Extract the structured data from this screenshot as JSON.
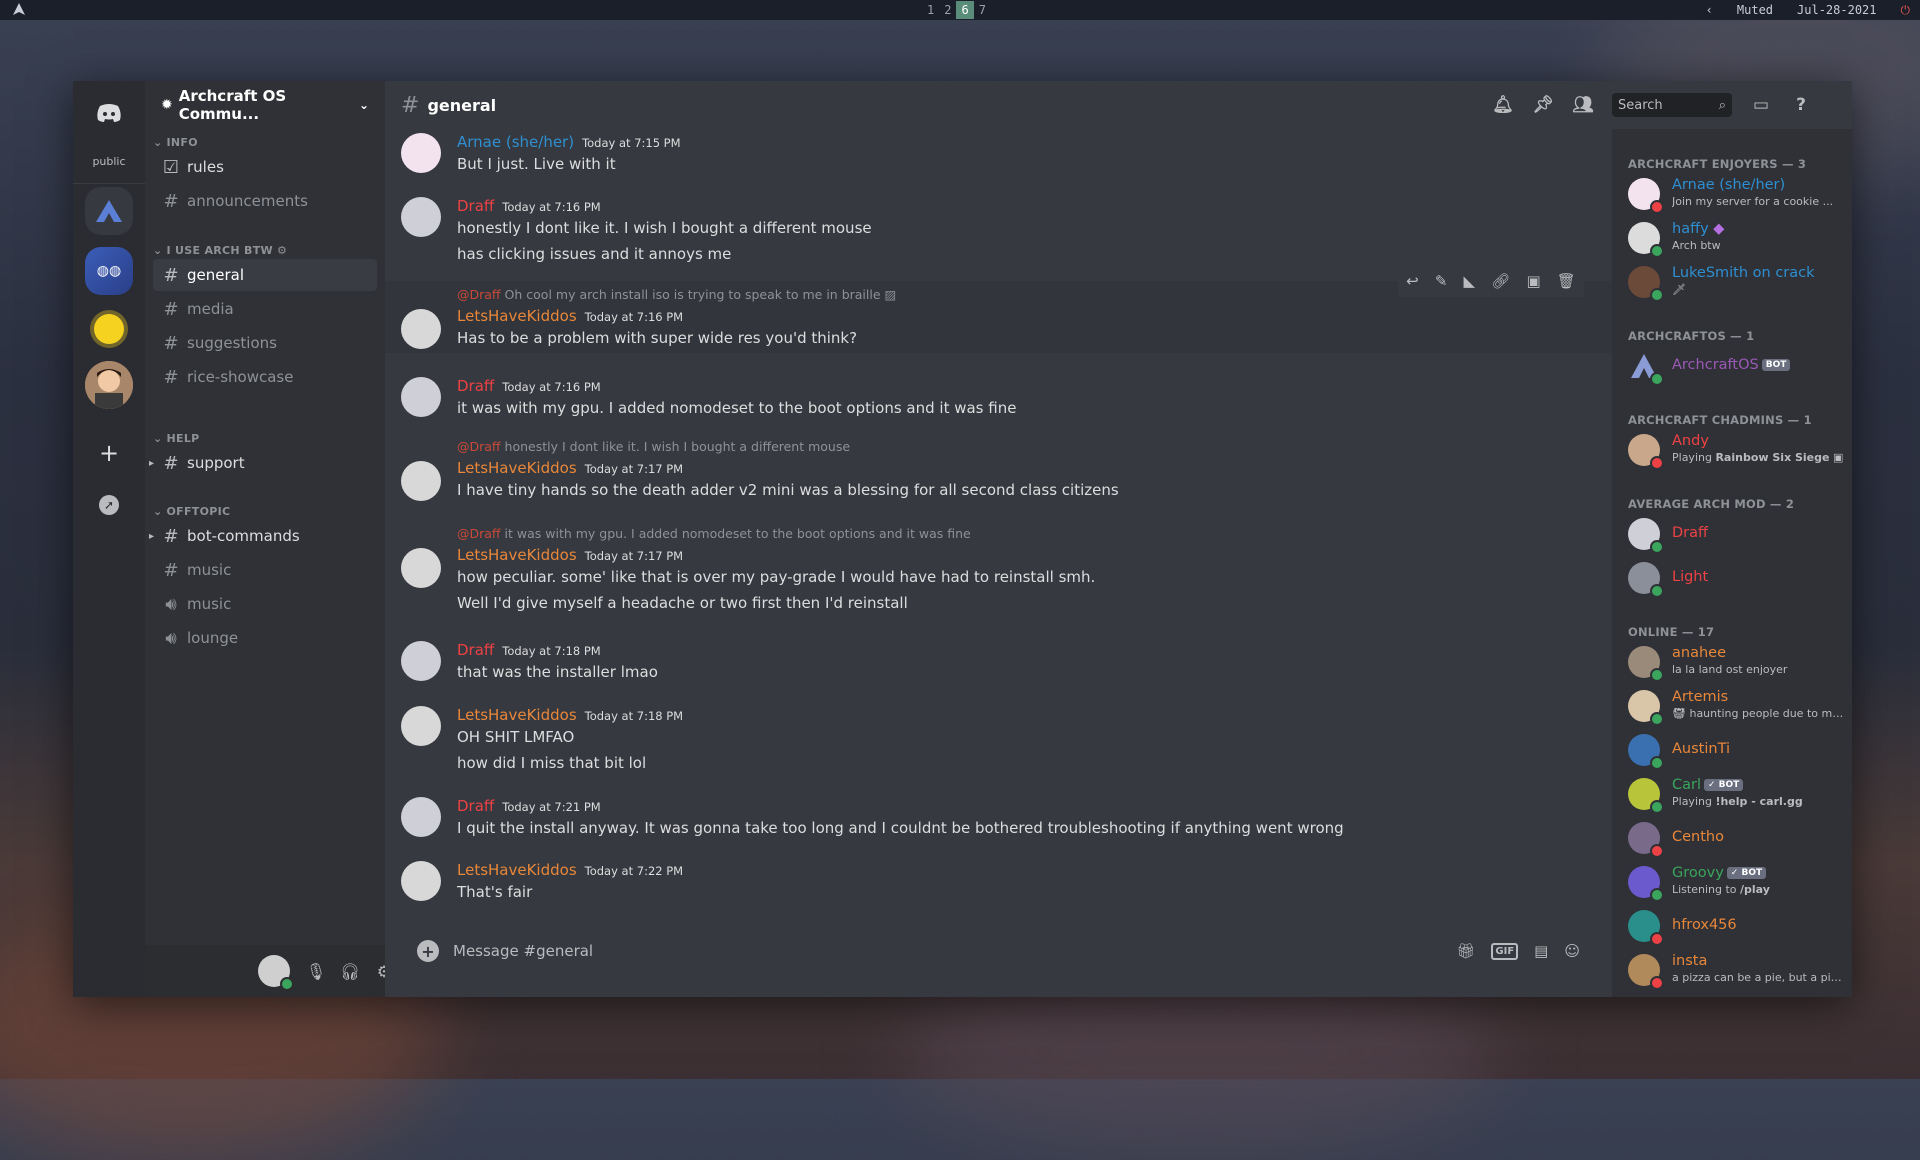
{
  "topbar": {
    "workspaces": [
      "1",
      "2",
      "6",
      "7"
    ],
    "active_workspace": "6",
    "audio_status": "Muted",
    "date": "Jul-28-2021"
  },
  "servers": {
    "public_label": "public"
  },
  "guild": {
    "name": "Archcraft OS Commu..."
  },
  "channels": {
    "categories": [
      {
        "label": "INFO",
        "channels": [
          "rules",
          "announcements"
        ]
      },
      {
        "label": "I USE ARCH BTW",
        "channels": [
          "general",
          "media",
          "suggestions",
          "rice-showcase"
        ]
      },
      {
        "label": "HELP",
        "channels": [
          "support"
        ]
      },
      {
        "label": "OFFTOPIC",
        "channels": [
          "bot-commands",
          "music",
          "music",
          "lounge"
        ]
      }
    ]
  },
  "chat": {
    "channel": "general",
    "search_placeholder": "Search",
    "composer_placeholder": "Message #general",
    "messages": [
      {
        "author": "Arnae (she/her)",
        "time": "Today at 7:15 PM",
        "lines": [
          "But I just. Live with it"
        ]
      },
      {
        "author": "Draff",
        "time": "Today at 7:16 PM",
        "lines": [
          "honestly I dont like it. I wish I bought a different mouse",
          "has clicking issues and it annoys me"
        ]
      },
      {
        "reply_to": "@Draff",
        "reply_text": "Oh cool my arch install iso is trying to speak to me in braille",
        "author": "LetsHaveKiddos",
        "time": "Today at 7:16 PM",
        "lines": [
          "Has to be a problem with super wide res you'd think?"
        ]
      },
      {
        "author": "Draff",
        "time": "Today at 7:16 PM",
        "lines": [
          "it was with my gpu. I added nomodeset to the boot options and it was fine"
        ]
      },
      {
        "reply_to": "@Draff",
        "reply_text": "honestly I dont like it. I wish I bought a different mouse",
        "author": "LetsHaveKiddos",
        "time": "Today at 7:17 PM",
        "lines": [
          "I have tiny hands so the death adder v2 mini was a blessing for all second class citizens"
        ]
      },
      {
        "reply_to": "@Draff",
        "reply_text": "it was with my gpu. I added nomodeset to the boot options and it was fine",
        "author": "LetsHaveKiddos",
        "time": "Today at 7:17 PM",
        "lines": [
          "how peculiar. some' like that is over my pay-grade I would have had to reinstall smh.",
          "Well I'd give myself a headache or two first then I'd reinstall"
        ]
      },
      {
        "author": "Draff",
        "time": "Today at 7:18 PM",
        "lines": [
          "that was the installer lmao"
        ]
      },
      {
        "author": "LetsHaveKiddos",
        "time": "Today at 7:18 PM",
        "lines": [
          "OH SHIT LMFAO",
          "how did I miss that bit lol"
        ]
      },
      {
        "author": "Draff",
        "time": "Today at 7:21 PM",
        "lines": [
          "I quit the install anyway. It was gonna take too long and I couldnt be bothered troubleshooting if anything went wrong"
        ]
      },
      {
        "author": "LetsHaveKiddos",
        "time": "Today at 7:22 PM",
        "lines": [
          "That's fair"
        ]
      }
    ]
  },
  "members": {
    "groups": [
      {
        "label": "ARCHCRAFT ENJOYERS — 3",
        "members": [
          {
            "name": "Arnae (she/her)",
            "activity": "Join my server for a cookie ..."
          },
          {
            "name": "haffy",
            "activity": "Arch btw"
          },
          {
            "name": "LukeSmith on crack",
            "activity": ""
          }
        ]
      },
      {
        "label": "ARCHCRAFTOS — 1",
        "members": [
          {
            "name": "ArchcraftOS",
            "tag": "BOT",
            "activity": ""
          }
        ]
      },
      {
        "label": "ARCHCRAFT CHADMINS — 1",
        "members": [
          {
            "name": "Andy",
            "activity_prefix": "Playing ",
            "activity_bold": "Rainbow Six Siege"
          }
        ]
      },
      {
        "label": "AVERAGE ARCH MOD — 2",
        "members": [
          {
            "name": "Draff",
            "activity": ""
          },
          {
            "name": "Light",
            "activity": ""
          }
        ]
      },
      {
        "label": "ONLINE — 17",
        "members": [
          {
            "name": "anahee",
            "activity": "la la land ost enjoyer"
          },
          {
            "name": "Artemis",
            "activity": "haunting people due to my ..."
          },
          {
            "name": "AustinTi",
            "activity": ""
          },
          {
            "name": "Carl",
            "tag": "✓ BOT",
            "activity_prefix": "Playing ",
            "activity_bold": "!help - carl.gg"
          },
          {
            "name": "Centho",
            "activity": ""
          },
          {
            "name": "Groovy",
            "tag": "✓ BOT",
            "activity_prefix": "Listening to ",
            "activity_bold": "/play"
          },
          {
            "name": "hfrox456",
            "activity": ""
          },
          {
            "name": "insta",
            "activity": "a pizza can be a pie, but a pie i..."
          }
        ]
      }
    ]
  },
  "colors": {
    "draff": "#ed4245",
    "lets": "#e8873a",
    "arnae": "#2f8fd1",
    "archcraft": "#9b59b6"
  }
}
